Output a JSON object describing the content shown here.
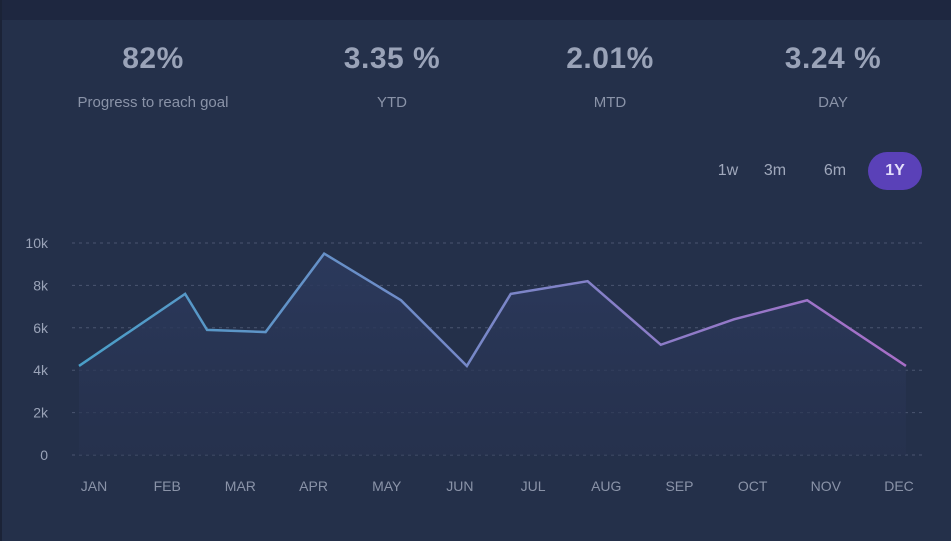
{
  "stats": [
    {
      "value": "82%",
      "label": "Progress to reach goal"
    },
    {
      "value": "3.35 %",
      "label": "YTD"
    },
    {
      "value": "2.01%",
      "label": "MTD"
    },
    {
      "value": "3.24 %",
      "label": "DAY"
    }
  ],
  "range_tabs": [
    {
      "label": "1w",
      "active": false
    },
    {
      "label": "3m",
      "active": false
    },
    {
      "label": "6m",
      "active": false
    },
    {
      "label": "1Y",
      "active": true
    }
  ],
  "colors": {
    "background": "#24304a",
    "line_start": "#4a9fc8",
    "line_end": "#a86ec8",
    "active_tab": "#5a41b8",
    "grid": "#3a4560"
  },
  "chart_data": {
    "type": "line",
    "title": "",
    "xlabel": "",
    "ylabel": "",
    "ylim": [
      0,
      10000
    ],
    "y_ticks": [
      {
        "value": 0,
        "label": "0"
      },
      {
        "value": 2000,
        "label": "2k"
      },
      {
        "value": 4000,
        "label": "4k"
      },
      {
        "value": 6000,
        "label": "6k"
      },
      {
        "value": 8000,
        "label": "8k"
      },
      {
        "value": 10000,
        "label": "10k"
      }
    ],
    "categories": [
      "JAN",
      "FEB",
      "MAR",
      "APR",
      "MAY",
      "JUN",
      "JUL",
      "AUG",
      "SEP",
      "OCT",
      "NOV",
      "DEC"
    ],
    "grid": true,
    "legend": "none",
    "series": [
      {
        "points": [
          {
            "x": 0,
            "y": 4200
          },
          {
            "x": 1.45,
            "y": 7600
          },
          {
            "x": 1.75,
            "y": 5900
          },
          {
            "x": 2.55,
            "y": 5800
          },
          {
            "x": 3.35,
            "y": 9500
          },
          {
            "x": 4.4,
            "y": 7300
          },
          {
            "x": 5.3,
            "y": 4200
          },
          {
            "x": 5.9,
            "y": 7600
          },
          {
            "x": 6.95,
            "y": 8200
          },
          {
            "x": 7.95,
            "y": 5200
          },
          {
            "x": 8.95,
            "y": 6400
          },
          {
            "x": 9.95,
            "y": 7300
          },
          {
            "x": 11.3,
            "y": 4200
          }
        ]
      }
    ]
  }
}
